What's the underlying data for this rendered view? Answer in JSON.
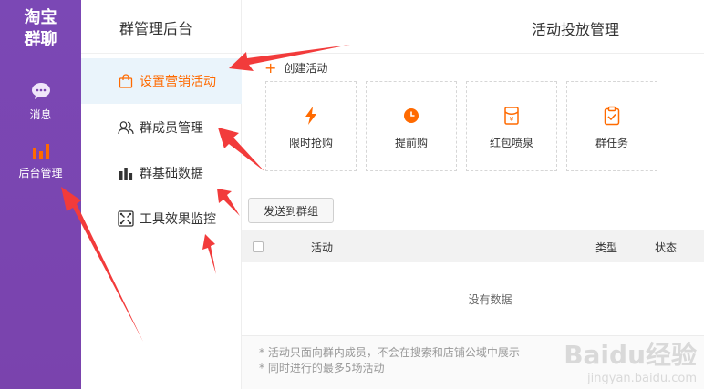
{
  "rail": {
    "logo_line1": "淘宝",
    "logo_line2": "群聊",
    "messages_label": "消息",
    "admin_label": "后台管理",
    "msg_icon": "chat-bubble-icon",
    "admin_icon": "bar-chart-icon"
  },
  "sidebar": {
    "title": "群管理后台",
    "items": [
      {
        "label": "设置营销活动",
        "icon": "shopping-bag-icon"
      },
      {
        "label": "群成员管理",
        "icon": "users-icon"
      },
      {
        "label": "群基础数据",
        "icon": "bar-chart-icon"
      },
      {
        "label": "工具效果监控",
        "icon": "monitor-icon"
      }
    ]
  },
  "main": {
    "title": "活动投放管理",
    "create_label": "创建活动",
    "cards": [
      {
        "label": "限时抢购",
        "icon": "lightning-icon"
      },
      {
        "label": "提前购",
        "icon": "clock-icon"
      },
      {
        "label": "红包喷泉",
        "icon": "red-packet-icon"
      },
      {
        "label": "群任务",
        "icon": "clipboard-check-icon"
      }
    ],
    "send_button": "发送到群组",
    "table": {
      "col_activity": "活动",
      "col_type": "类型",
      "col_status": "状态",
      "empty": "没有数据"
    },
    "notes": [
      "* 活动只面向群内成员，不会在搜索和店铺公域中展示",
      "* 同时进行的最多5场活动"
    ]
  },
  "watermark": {
    "line1": "Baidu经验",
    "line2": "jingyan.baidu.com"
  },
  "colors": {
    "accent": "#ff6a00",
    "rail": "#7a45b0",
    "arrow": "#f23b3b",
    "active_bg": "#eaf4fb"
  }
}
